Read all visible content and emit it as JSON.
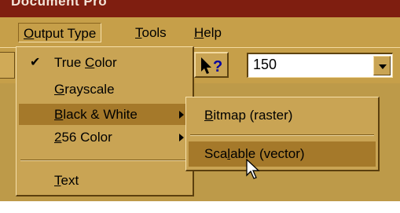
{
  "window": {
    "title": "Document Pro"
  },
  "menubar": [
    {
      "label_underline": "O",
      "label_rest": "utput Type",
      "open": true
    },
    {
      "label_underline": "T",
      "label_rest": "ools",
      "open": false
    },
    {
      "label_underline": "H",
      "label_rest": "elp",
      "open": false
    }
  ],
  "toolbar": {
    "help_button_icon": "whats-this-help-icon",
    "resolution_value": "150"
  },
  "output_type_menu": {
    "items": [
      {
        "pre": "True ",
        "u": "C",
        "post": "olor",
        "checked": true
      },
      {
        "pre": "",
        "u": "G",
        "post": "rayscale"
      },
      {
        "pre": "",
        "u": "B",
        "post": "lack & White",
        "submenu": true,
        "active": true
      },
      {
        "pre": "",
        "u": "2",
        "post": "56 Color",
        "submenu": true
      },
      {
        "pre": "",
        "u": "T",
        "post": "ext"
      }
    ]
  },
  "black_white_submenu": {
    "items": [
      {
        "pre": "",
        "u": "B",
        "post": "itmap (raster)"
      },
      {
        "pre": "Sca",
        "u": "l",
        "post": "able (vector)",
        "active": true
      }
    ]
  },
  "colors": {
    "menubar": "#c69f49",
    "highlight": "#a5792a",
    "titlebar": "#7f1e10"
  }
}
